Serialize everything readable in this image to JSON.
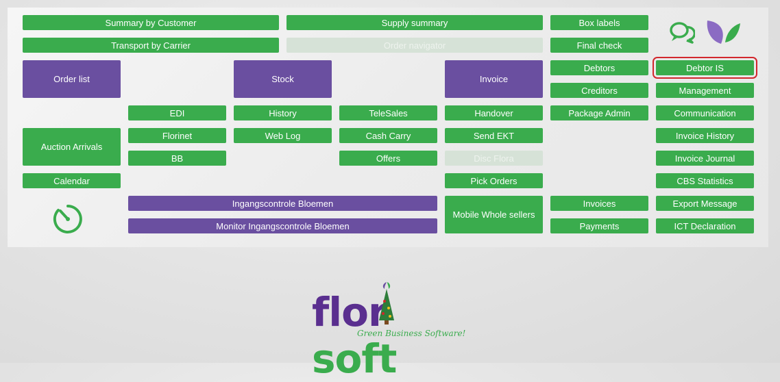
{
  "menu": {
    "summary_by_customer": "Summary by Customer",
    "supply_summary": "Supply summary",
    "box_labels": "Box labels",
    "transport_by_carrier": "Transport by Carrier",
    "order_navigator": "Order navigator",
    "final_check": "Final check",
    "order_list": "Order list",
    "stock": "Stock",
    "invoice": "Invoice",
    "debtors": "Debtors",
    "debtor_is": "Debtor IS",
    "creditors": "Creditors",
    "management": "Management",
    "edi": "EDI",
    "history": "History",
    "telesales": "TeleSales",
    "handover": "Handover",
    "package_admin": "Package Admin",
    "communication": "Communication",
    "auction_arrivals": "Auction Arrivals",
    "florinet": "Florinet",
    "web_log": "Web Log",
    "cash_carry": "Cash Carry",
    "send_ekt": "Send EKT",
    "invoice_history": "Invoice History",
    "bb": "BB",
    "offers": "Offers",
    "disc_flora": "Disc Flora",
    "invoice_journal": "Invoice Journal",
    "calendar": "Calendar",
    "pick_orders": "Pick Orders",
    "cbs_statistics": "CBS Statistics",
    "ingangscontrole_bloemen": "Ingangscontrole Bloemen",
    "mobile_whole_sellers": "Mobile Whole sellers",
    "invoices": "Invoices",
    "export_message": "Export Message",
    "monitor_ingangscontrole_bloemen": "Monitor Ingangscontrole Bloemen",
    "payments": "Payments",
    "ict_declaration": "ICT Declaration"
  },
  "logo": {
    "text_part1": "flor",
    "text_part2": "soft",
    "tagline": "Green Business Software!"
  },
  "icons": {
    "chat": "chat-bubbles-icon",
    "leaf": "leaf-icon",
    "timer": "timer-icon"
  },
  "colors": {
    "green": "#3aac4d",
    "purple": "#6a4fa0",
    "highlight": "#d2262c",
    "disabled": "#d6e2d7"
  }
}
